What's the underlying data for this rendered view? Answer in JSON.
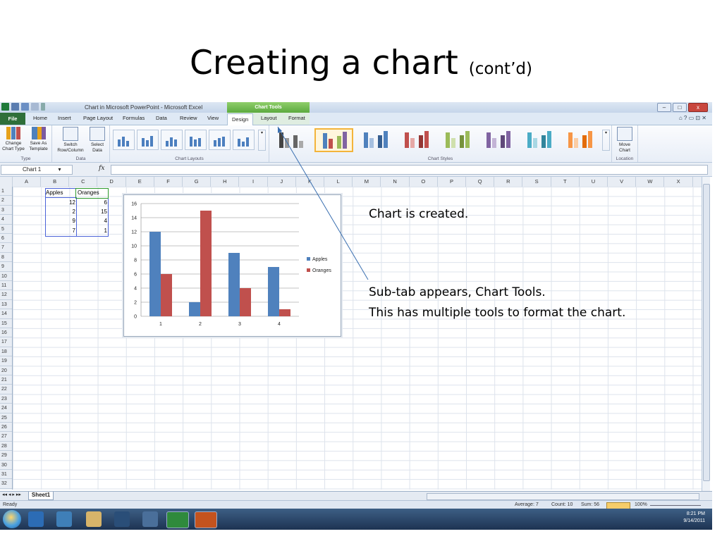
{
  "slide": {
    "title": "Creating a chart",
    "title_suffix": "(cont’d)",
    "note1": "Chart is created.",
    "note2_line1": "Sub-tab appears, Chart Tools.",
    "note2_line2": "This has multiple tools to format the chart.",
    "callout_color": "#3a6fb0"
  },
  "excel": {
    "window_title": "Chart in Microsoft PowerPoint - Microsoft Excel",
    "context_tab_group": "Chart Tools",
    "tabs": [
      "File",
      "Home",
      "Insert",
      "Page Layout",
      "Formulas",
      "Data",
      "Review",
      "View",
      "Design",
      "Layout",
      "Format"
    ],
    "selected_tab": "Design",
    "ribbon": {
      "type_group": "Type",
      "change_chart_type": "Change Chart Type",
      "save_as_template": "Save As Template",
      "data_group": "Data",
      "switch_row_column": "Switch Row/Column",
      "select_data": "Select Data",
      "chart_layouts_group": "Chart Layouts",
      "chart_styles_group": "Chart Styles",
      "location_group": "Location",
      "move_chart": "Move Chart"
    },
    "name_box": "Chart 1",
    "fx_label": "fx",
    "columns": [
      "A",
      "B",
      "C",
      "D",
      "E",
      "F",
      "G",
      "H",
      "I",
      "J",
      "K",
      "L",
      "M",
      "N",
      "O",
      "P",
      "Q",
      "R",
      "S",
      "T",
      "U",
      "V",
      "W",
      "X"
    ],
    "rows": [
      "1",
      "2",
      "3",
      "4",
      "5",
      "6",
      "7",
      "8",
      "9",
      "10",
      "11",
      "12",
      "13",
      "14",
      "15",
      "16",
      "17",
      "18",
      "19",
      "20",
      "21",
      "22",
      "23",
      "24",
      "25",
      "26",
      "27",
      "28",
      "29",
      "30",
      "31",
      "32"
    ],
    "cells": {
      "B1": "Apples",
      "C1": "Oranges",
      "B2": "12",
      "C2": "6",
      "B3": "2",
      "C3": "15",
      "B4": "9",
      "C4": "4",
      "B5": "7",
      "C5": "1"
    },
    "sheet_tab": "Sheet1",
    "status": {
      "ready": "Ready",
      "average": "Average: 7",
      "count": "Count: 10",
      "sum": "Sum: 56",
      "zoom": "100%"
    },
    "taskbar": {
      "time": "8:21 PM",
      "date": "9/14/2011"
    }
  },
  "chart_data": {
    "type": "bar",
    "categories": [
      "1",
      "2",
      "3",
      "4"
    ],
    "series": [
      {
        "name": "Apples",
        "values": [
          12,
          2,
          9,
          7
        ],
        "color": "#4f81bd"
      },
      {
        "name": "Oranges",
        "values": [
          6,
          15,
          4,
          1
        ],
        "color": "#c0504d"
      }
    ],
    "ylim": [
      0,
      16
    ],
    "yticks": [
      0,
      2,
      4,
      6,
      8,
      10,
      12,
      14,
      16
    ],
    "grid": true,
    "legend": "right"
  }
}
